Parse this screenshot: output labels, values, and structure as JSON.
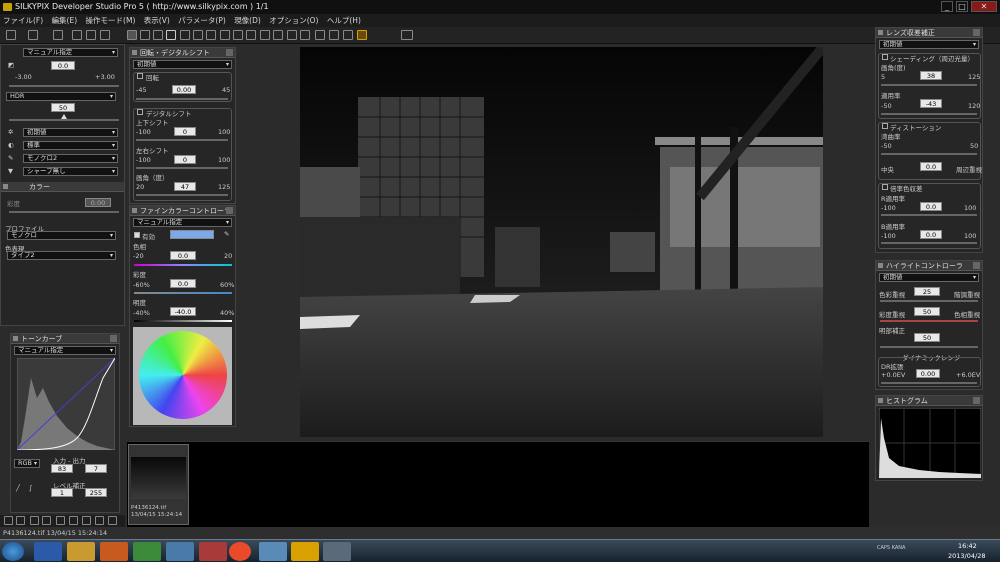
{
  "window": {
    "title": "SILKYPIX Developer Studio Pro 5 ( http://www.silkypix.com )    1/1",
    "min": "_",
    "max": "□",
    "close": "✕"
  },
  "menu": [
    "ファイル(F)",
    "編集(E)",
    "操作モード(M)",
    "表示(V)",
    "パラメータ(P)",
    "現像(D)",
    "オプション(O)",
    "ヘルプ(H)"
  ],
  "left": {
    "exposure_mode": "マニュアル指定",
    "exposure_value": "0.0",
    "exposure_min": "-3.00",
    "exposure_max": "+3.00",
    "hdr_label": "HDR",
    "hdr_value": "50",
    "presets": [
      "初期値",
      "標準",
      "モノクロ2",
      "シャープ無し"
    ],
    "color_title": "カラー",
    "saturation_label": "彩度",
    "saturation_value": "0.00",
    "profile_label": "プロファイル",
    "profile_value": "モノクロ",
    "color_rep_label": "色表現",
    "color_rep_value": "タイプ2"
  },
  "tone": {
    "title": "トーンカーブ",
    "mode": "マニュアル指定",
    "channel": "RGB",
    "io_label": "入力 - 出力",
    "in_value": "83",
    "out_value": "7",
    "level_label": "レベル補正",
    "level_min": "1",
    "level_max": "255"
  },
  "rotate": {
    "title": "回転・デジタルシフト",
    "preset": "初期値",
    "rotate_label": "回転",
    "rotate_value": "0.00",
    "rotate_min": "-45",
    "rotate_max": "45",
    "shift_label": "デジタルシフト",
    "vshift_label": "上下シフト",
    "vshift_value": "0",
    "hshift_label": "左右シフト",
    "hshift_value": "0",
    "angle_label": "画角（度）",
    "angle_value": "47",
    "min100": "-100",
    "max100": "100",
    "angle_min": "20",
    "angle_max": "125"
  },
  "fine": {
    "title": "ファインカラーコントローラ",
    "mode": "マニュアル指定",
    "enabled_label": "有効",
    "hue_label": "色相",
    "hue_value": "0.0",
    "hue_min": "-20",
    "hue_max": "20",
    "sat_label": "彩度",
    "sat_value": "0.0",
    "sat_min": "-60%",
    "sat_max": "60%",
    "lum_label": "明度",
    "lum_value": "-40.0",
    "lum_min": "-40%",
    "lum_max": "40%",
    "swatch_color": "#7aa8e8"
  },
  "lens": {
    "title": "レンズ収差補正",
    "preset": "初期値",
    "shading_label": "シェーディング（周辺光量）",
    "angle_label": "画角(度)",
    "angle_value": "38",
    "angle_min": "5",
    "angle_max": "125",
    "rate_label": "適用率",
    "rate_value": "-43",
    "rate_min": "-50",
    "rate_max": "120",
    "distortion_label": "ディストーション",
    "dist_rate_label": "湾曲率",
    "dist_min": "-50",
    "dist_max": "50",
    "center_label": "中央",
    "center_value": "0.0",
    "edge_label": "周辺重視",
    "chroma_label": "倍率色収差",
    "r_label": "R適用率",
    "r_value": "0.0",
    "b_label": "B適用率",
    "b_value": "0.0",
    "min100": "-100",
    "max100": "100"
  },
  "highlight": {
    "title": "ハイライトコントローラ",
    "preset": "初期値",
    "hue_left": "色彩重視",
    "hue_right": "階調重視",
    "hue_value": "25",
    "sat_left": "彩度重視",
    "sat_right": "色相重視",
    "sat_value": "50",
    "bright_label": "明部補正",
    "bright_value": "50",
    "dr_title": "ダイナミックレンジ",
    "dr_label": "DR拡張",
    "dr_min": "+0.0EV",
    "dr_value": "0.00",
    "dr_max": "+6.0EV"
  },
  "histogram": {
    "title": "ヒストグラム"
  },
  "thumb": {
    "name": "P4136124.tif",
    "date": "13/04/15 15:24:14"
  },
  "status": {
    "text": "P4136124.tif 13/04/15 15:24:14"
  },
  "taskbar": {
    "time": "16:42",
    "date": "2013/04/28",
    "lang": "CAPS KANA"
  }
}
